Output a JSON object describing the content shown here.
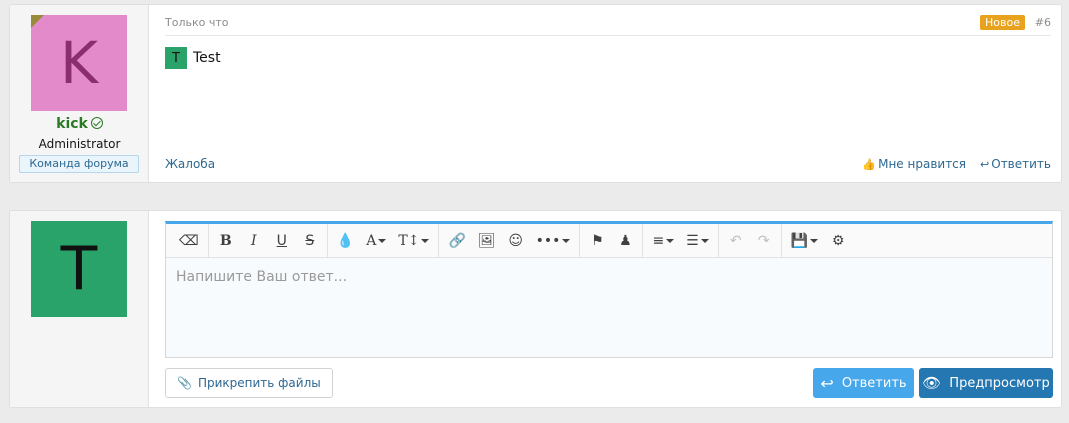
{
  "post": {
    "avatar_letter": "K",
    "username": "kick",
    "user_title": "Administrator",
    "banner": "Команда форума",
    "time": "Только что",
    "badge": "Новое",
    "number": "#6",
    "inline_avatar": "T",
    "text": "Test",
    "actions": {
      "report": "Жалоба",
      "like": "Мне нравится",
      "reply": "Ответить"
    }
  },
  "reply": {
    "avatar_letter": "T",
    "placeholder": "Напишите Ваш ответ...",
    "attach_label": "Прикрепить файлы",
    "reply_label": "Ответить",
    "preview_label": "Предпросмотр"
  },
  "colors": {
    "accent": "#47a7eb",
    "primary_button": "#2577b1",
    "badge_new": "#e9a21e",
    "username": "#2a7a25"
  }
}
